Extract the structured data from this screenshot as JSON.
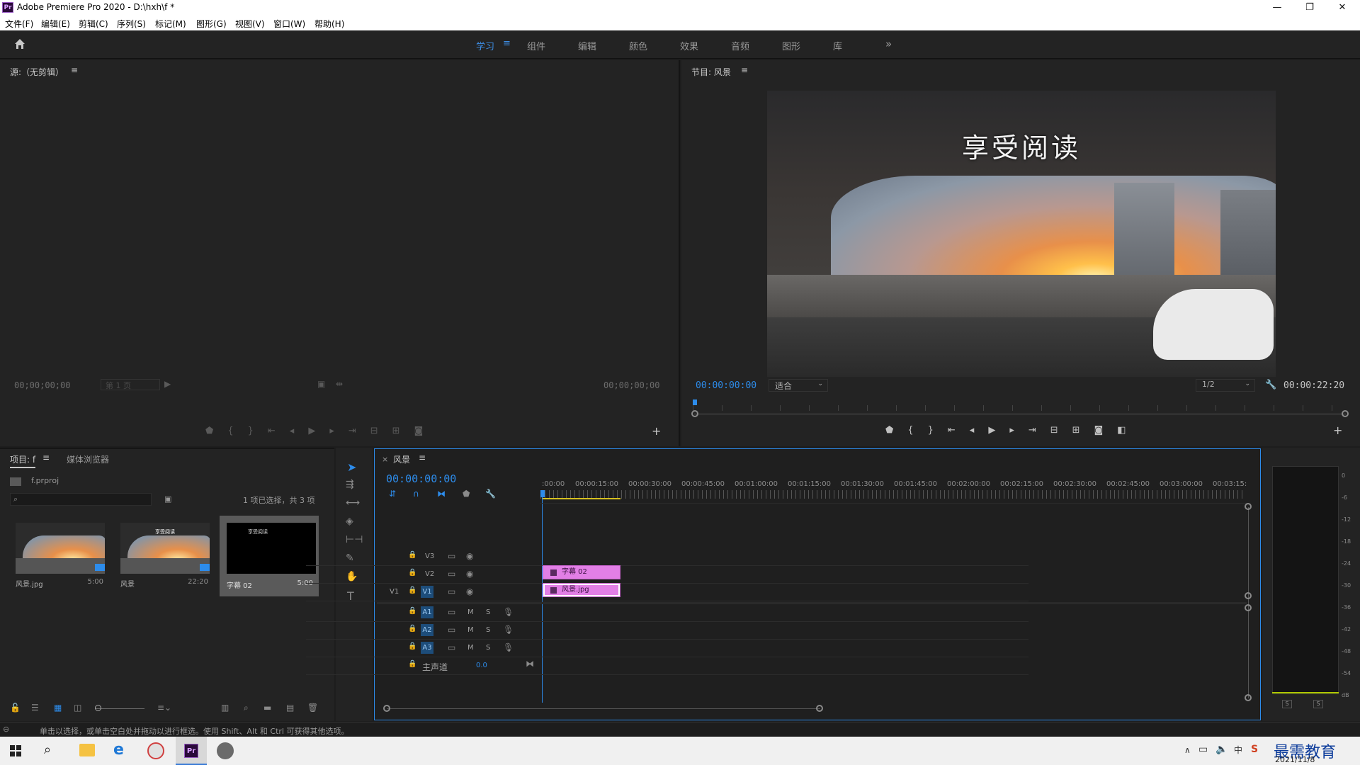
{
  "window": {
    "title": "Adobe Premiere Pro 2020 - D:\\hxh\\f *",
    "logo": "Pr",
    "controls": {
      "minimize": "—",
      "maximize": "❐",
      "close": "✕"
    }
  },
  "menu": [
    "文件(F)",
    "编辑(E)",
    "剪辑(C)",
    "序列(S)",
    "标记(M)",
    "图形(G)",
    "视图(V)",
    "窗口(W)",
    "帮助(H)"
  ],
  "workspaces": {
    "items": [
      "学习",
      "组件",
      "编辑",
      "颜色",
      "效果",
      "音频",
      "图形",
      "库"
    ],
    "active": "学习",
    "more": "»"
  },
  "source_monitor": {
    "title": "源:（无剪辑）",
    "timecode_left": "00;00;00;00",
    "page": "第 1 页",
    "timecode_right": "00;00;00;00"
  },
  "program_monitor": {
    "title": "节目: 风景",
    "image_title_text": "享受阅读",
    "timecode": "00:00:00:00",
    "fit": "适合",
    "resolution": "1/2",
    "duration": "00:00:22:20"
  },
  "project": {
    "tab_project": "项目: f",
    "tab_media": "媒体浏览器",
    "file": "f.prproj",
    "selection": "1 项已选择，共 3 项",
    "search_placeholder": "",
    "items": [
      {
        "name": "风景.jpg",
        "duration": "5:00"
      },
      {
        "name": "风景",
        "duration": "22:20"
      },
      {
        "name": "字幕 02",
        "duration": "5:00"
      }
    ],
    "thumb2_caption": "享受阅读",
    "thumb3_caption": "享受阅读"
  },
  "timeline": {
    "tab": "风景",
    "close": "×",
    "timecode": "00:00:00:00",
    "ruler": [
      ":00:00",
      "00:00:15:00",
      "00:00:30:00",
      "00:00:45:00",
      "00:01:00:00",
      "00:01:15:00",
      "00:01:30:00",
      "00:01:45:00",
      "00:02:00:00",
      "00:02:15:00",
      "00:02:30:00",
      "00:02:45:00",
      "00:03:00:00",
      "00:03:15:"
    ],
    "video_tracks": [
      "V3",
      "V2",
      "V1"
    ],
    "source_patch": "V1",
    "audio_tracks": [
      "A1",
      "A2",
      "A3"
    ],
    "mute": "M",
    "solo": "S",
    "master": {
      "label": "主声道",
      "value": "0.0"
    },
    "clips": {
      "v2": "字幕 02",
      "v1": "风景.jpg"
    }
  },
  "audio_meter": {
    "scale": [
      "0",
      "-6",
      "-12",
      "-18",
      "-24",
      "-30",
      "-36",
      "-42",
      "-48",
      "-54",
      "dB"
    ],
    "solo_left": "S",
    "solo_right": "S"
  },
  "status": "单击以选择，或单击空白处并拖动以进行框选。使用 Shift、Alt 和 Ctrl 可获得其他选项。",
  "taskbar": {
    "date": "2021/11/8",
    "ime": "中",
    "watermark": "最需教育"
  },
  "colors": {
    "accent": "#2d8ceb",
    "clip": "#e27fe6",
    "panel": "#232323"
  }
}
